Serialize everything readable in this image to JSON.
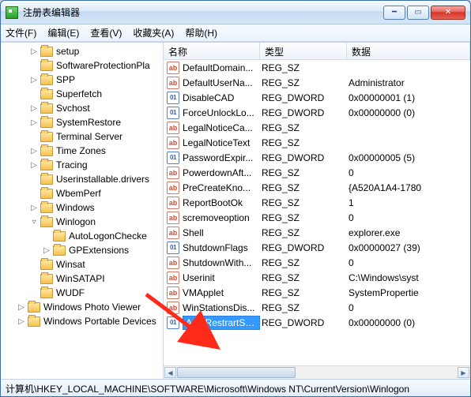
{
  "window": {
    "title": "注册表编辑器"
  },
  "menu": {
    "file": "文件(F)",
    "edit": "编辑(E)",
    "view": "查看(V)",
    "favorites": "收藏夹(A)",
    "help": "帮助(H)"
  },
  "tree": {
    "items": [
      {
        "lvl": "lvl1",
        "tw": "▷",
        "label": "setup"
      },
      {
        "lvl": "lvl1",
        "tw": "",
        "label": "SoftwareProtectionPla"
      },
      {
        "lvl": "lvl1",
        "tw": "▷",
        "label": "SPP"
      },
      {
        "lvl": "lvl1",
        "tw": "",
        "label": "Superfetch"
      },
      {
        "lvl": "lvl1",
        "tw": "▷",
        "label": "Svchost"
      },
      {
        "lvl": "lvl1",
        "tw": "▷",
        "label": "SystemRestore"
      },
      {
        "lvl": "lvl1",
        "tw": "",
        "label": "Terminal Server"
      },
      {
        "lvl": "lvl1",
        "tw": "▷",
        "label": "Time Zones"
      },
      {
        "lvl": "lvl1",
        "tw": "▷",
        "label": "Tracing"
      },
      {
        "lvl": "lvl1",
        "tw": "",
        "label": "Userinstallable.drivers"
      },
      {
        "lvl": "lvl1",
        "tw": "",
        "label": "WbemPerf"
      },
      {
        "lvl": "lvl1",
        "tw": "▷",
        "label": "Windows"
      },
      {
        "lvl": "lvl1",
        "tw": "▿",
        "label": "Winlogon",
        "sel": true
      },
      {
        "lvl": "lvl2",
        "tw": "",
        "label": "AutoLogonChecke"
      },
      {
        "lvl": "lvl2",
        "tw": "▷",
        "label": "GPExtensions"
      },
      {
        "lvl": "lvl1",
        "tw": "",
        "label": "Winsat"
      },
      {
        "lvl": "lvl1",
        "tw": "",
        "label": "WinSATAPI"
      },
      {
        "lvl": "lvl1",
        "tw": "",
        "label": "WUDF"
      },
      {
        "lvl": "lvl0",
        "tw": "▷",
        "label": "Windows Photo Viewer"
      },
      {
        "lvl": "lvl0",
        "tw": "▷",
        "label": "Windows Portable Devices"
      }
    ]
  },
  "columns": {
    "name": "名称",
    "type": "类型",
    "data": "数据"
  },
  "rows": [
    {
      "icon": "sz",
      "name": "DefaultDomain...",
      "type": "REG_SZ",
      "data": ""
    },
    {
      "icon": "sz",
      "name": "DefaultUserNa...",
      "type": "REG_SZ",
      "data": "Administrator"
    },
    {
      "icon": "dw",
      "name": "DisableCAD",
      "type": "REG_DWORD",
      "data": "0x00000001 (1)"
    },
    {
      "icon": "dw",
      "name": "ForceUnlockLo...",
      "type": "REG_DWORD",
      "data": "0x00000000 (0)"
    },
    {
      "icon": "sz",
      "name": "LegalNoticeCa...",
      "type": "REG_SZ",
      "data": ""
    },
    {
      "icon": "sz",
      "name": "LegalNoticeText",
      "type": "REG_SZ",
      "data": ""
    },
    {
      "icon": "dw",
      "name": "PasswordExpir...",
      "type": "REG_DWORD",
      "data": "0x00000005 (5)"
    },
    {
      "icon": "sz",
      "name": "PowerdownAft...",
      "type": "REG_SZ",
      "data": "0"
    },
    {
      "icon": "sz",
      "name": "PreCreateKno...",
      "type": "REG_SZ",
      "data": "{A520A1A4-1780"
    },
    {
      "icon": "sz",
      "name": "ReportBootOk",
      "type": "REG_SZ",
      "data": "1"
    },
    {
      "icon": "sz",
      "name": "scremoveoption",
      "type": "REG_SZ",
      "data": "0"
    },
    {
      "icon": "sz",
      "name": "Shell",
      "type": "REG_SZ",
      "data": "explorer.exe"
    },
    {
      "icon": "dw",
      "name": "ShutdownFlags",
      "type": "REG_DWORD",
      "data": "0x00000027 (39)"
    },
    {
      "icon": "sz",
      "name": "ShutdownWith...",
      "type": "REG_SZ",
      "data": "0"
    },
    {
      "icon": "sz",
      "name": "Userinit",
      "type": "REG_SZ",
      "data": "C:\\Windows\\syst"
    },
    {
      "icon": "sz",
      "name": "VMApplet",
      "type": "REG_SZ",
      "data": "SystemPropertie"
    },
    {
      "icon": "sz",
      "name": "WinStationsDis...",
      "type": "REG_SZ",
      "data": "0"
    },
    {
      "icon": "dw",
      "name": "AutoRestrartSh...",
      "type": "REG_DWORD",
      "data": "0x00000000 (0)",
      "sel": true
    }
  ],
  "status": "计算机\\HKEY_LOCAL_MACHINE\\SOFTWARE\\Microsoft\\Windows NT\\CurrentVersion\\Winlogon"
}
